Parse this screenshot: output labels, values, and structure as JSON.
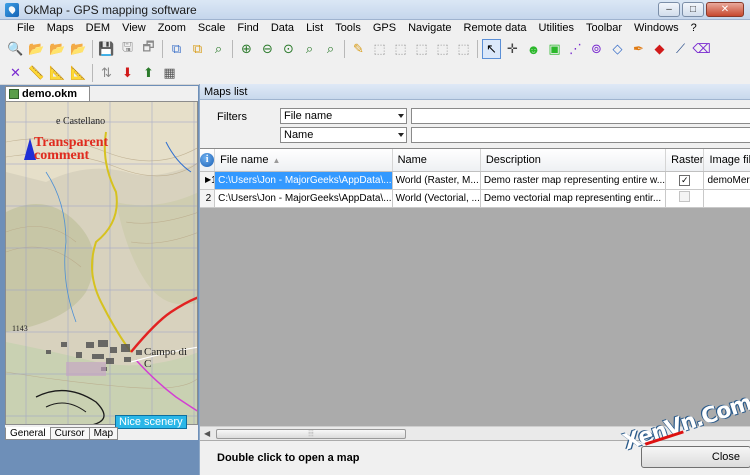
{
  "window": {
    "title": "OkMap - GPS mapping software",
    "buttons": [
      "–",
      "□",
      "✕"
    ]
  },
  "menu": [
    "File",
    "Maps",
    "DEM",
    "View",
    "Zoom",
    "Scale",
    "Find",
    "Data",
    "List",
    "Tools",
    "GPS",
    "Navigate",
    "Remote data",
    "Utilities",
    "Toolbar",
    "Windows",
    "?"
  ],
  "toolbar1": [
    {
      "icon": "open-map-icon",
      "glyph": "🔍",
      "color": "#2b7a2b"
    },
    {
      "icon": "open-folder-icon",
      "glyph": "📂",
      "color": "#c9a227"
    },
    {
      "icon": "folder-edit-icon",
      "glyph": "📂",
      "color": "#c9a227"
    },
    {
      "icon": "folder-arrow-icon",
      "glyph": "📂",
      "color": "#c9a227"
    },
    {
      "icon": "save-icon",
      "glyph": "💾",
      "color": "#2b4e8a"
    },
    {
      "icon": "save-as-icon",
      "glyph": "🖫",
      "color": "#8a8a8a"
    },
    {
      "icon": "close-map-icon",
      "glyph": "🗗",
      "color": "#8a8a8a"
    },
    {
      "icon": "layers-icon",
      "glyph": "⧉",
      "color": "#3a6fc9"
    },
    {
      "icon": "copy-icon",
      "glyph": "⧉",
      "color": "#d79a12"
    },
    {
      "icon": "find-icon",
      "glyph": "⌕",
      "color": "#2b7a2b"
    },
    {
      "icon": "zoom-in-icon",
      "glyph": "⊕",
      "color": "#2b7a2b"
    },
    {
      "icon": "zoom-out-icon",
      "glyph": "⊖",
      "color": "#2b7a2b"
    },
    {
      "icon": "zoom-fit-icon",
      "glyph": "⊙",
      "color": "#2b7a2b"
    },
    {
      "icon": "zoom-window-icon",
      "glyph": "⌕",
      "color": "#2b7a2b"
    },
    {
      "icon": "zoom-1to1-icon",
      "glyph": "⌕",
      "color": "#2b7a2b"
    },
    {
      "icon": "waypoint-edit-icon",
      "glyph": "✎",
      "color": "#d79a12"
    },
    {
      "icon": "track-point-icon",
      "glyph": "⬚",
      "color": "#9a9a9a"
    },
    {
      "icon": "track-edit-icon",
      "glyph": "⬚",
      "color": "#9a9a9a"
    },
    {
      "icon": "route-edit-icon",
      "glyph": "⬚",
      "color": "#9a9a9a"
    },
    {
      "icon": "route-point-icon",
      "glyph": "⬚",
      "color": "#9a9a9a"
    },
    {
      "icon": "select-point-icon",
      "glyph": "⬚",
      "color": "#9a9a9a"
    },
    {
      "icon": "pointer-icon",
      "glyph": "↖",
      "color": "#000000",
      "selected": true
    },
    {
      "icon": "crosshair-icon",
      "glyph": "✛",
      "color": "#444444"
    },
    {
      "icon": "smiley-waypoint-icon",
      "glyph": "☻",
      "color": "#2bb82b"
    },
    {
      "icon": "comment-icon",
      "glyph": "▣",
      "color": "#2bb82b"
    },
    {
      "icon": "track-dots-icon",
      "glyph": "⋰",
      "color": "#7a2bd0"
    },
    {
      "icon": "route-dots-icon",
      "glyph": "⊚",
      "color": "#7a2bd0"
    },
    {
      "icon": "polygon-icon",
      "glyph": "◇",
      "color": "#3a6fc9"
    },
    {
      "icon": "pen-orange-icon",
      "glyph": "✒",
      "color": "#e07a12"
    },
    {
      "icon": "red-diamond-icon",
      "glyph": "◆",
      "color": "#d11a1a"
    },
    {
      "icon": "measure-icon",
      "glyph": "⟋",
      "color": "#2b4e8a"
    },
    {
      "icon": "erase-icon",
      "glyph": "⌫",
      "color": "#7a2bd0"
    }
  ],
  "toolbar2": [
    {
      "icon": "cancel-track-icon",
      "glyph": "✕",
      "color": "#7a2bd0"
    },
    {
      "icon": "ruler-icon",
      "glyph": "📏",
      "color": "#d7c012"
    },
    {
      "icon": "ruler-edit-icon",
      "glyph": "📐",
      "color": "#d7c012"
    },
    {
      "icon": "ruler-move-icon",
      "glyph": "📐",
      "color": "#d7c012"
    },
    {
      "icon": "gps-connect-icon",
      "glyph": "⇅",
      "color": "#8a8a8a"
    },
    {
      "icon": "gps-download-icon",
      "glyph": "⬇",
      "color": "#d11a1a"
    },
    {
      "icon": "gps-upload-icon",
      "glyph": "⬆",
      "color": "#2b7a2b"
    },
    {
      "icon": "gps-settings-icon",
      "glyph": "▦",
      "color": "#555555"
    }
  ],
  "map": {
    "tab": "demo.okm",
    "annotation": "Transparent comment",
    "labels": [
      "e Castellano",
      "Campo di C",
      "1143",
      "Nice scenery"
    ],
    "bottom_tabs": [
      "General",
      "Cursor",
      "Map"
    ]
  },
  "maps_list": {
    "title": "Maps list",
    "filters_label": "Filters",
    "filter1": "File name",
    "filter2": "Name",
    "columns": [
      "File name",
      "Name",
      "Description",
      "Raster",
      "Image file name"
    ],
    "rows": [
      {
        "num": "1",
        "file": "C:\\Users\\Jon - MajorGeeks\\AppData\\...",
        "name": "World (Raster, M...",
        "desc": "Demo raster map representing entire w...",
        "raster": true,
        "image": "demoMercator.gif",
        "current": true
      },
      {
        "num": "2",
        "file": "C:\\Users\\Jon - MajorGeeks\\AppData\\...",
        "name": "World (Vectorial, ...",
        "desc": "Demo vectorial map representing entir...",
        "raster": false,
        "image": "",
        "current": false
      }
    ],
    "hint": "Double click to open a map",
    "close": "Close"
  },
  "watermark": "XenVn.Com"
}
